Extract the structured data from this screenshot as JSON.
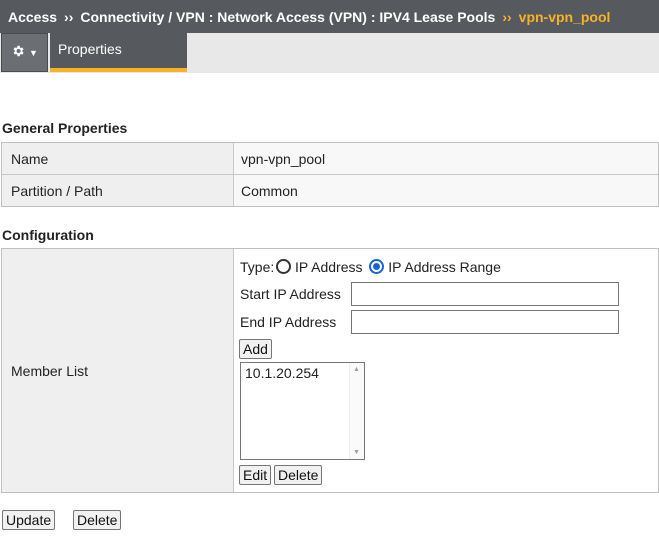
{
  "breadcrumb": {
    "items": [
      "Access",
      "Connectivity / VPN : Network Access (VPN) : IPV4 Lease Pools"
    ],
    "current": "vpn-vpn_pool",
    "separator": "››"
  },
  "toolbar": {
    "gear_icon": "gear-icon",
    "tab_properties": "Properties"
  },
  "general": {
    "title": "General Properties",
    "rows": [
      {
        "label": "Name",
        "value": "vpn-vpn_pool"
      },
      {
        "label": "Partition / Path",
        "value": "Common"
      }
    ]
  },
  "configuration": {
    "title": "Configuration",
    "member_list_label": "Member List",
    "type_label": "Type:",
    "type_options": [
      "IP Address",
      "IP Address Range"
    ],
    "type_selected": "IP Address Range",
    "start_ip_label": "Start IP Address",
    "start_ip_value": "",
    "end_ip_label": "End IP Address",
    "end_ip_value": "",
    "add_label": "Add",
    "members": [
      "10.1.20.254"
    ],
    "edit_label": "Edit",
    "delete_label": "Delete"
  },
  "footer": {
    "update_label": "Update",
    "delete_label": "Delete"
  },
  "colors": {
    "header_bg": "#56595d",
    "accent": "#f6b326",
    "radio_selected": "#1565d8"
  }
}
